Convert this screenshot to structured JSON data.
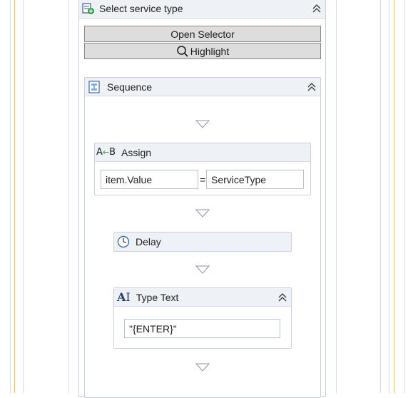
{
  "select_service": {
    "title": "Select service type",
    "open_selector_label": "Open Selector",
    "highlight_label": "Highlight"
  },
  "sequence": {
    "title": "Sequence"
  },
  "assign": {
    "title": "Assign",
    "left_value": "item.Value",
    "operator": "=",
    "right_value": "ServiceType"
  },
  "delay": {
    "title": "Delay"
  },
  "type_text": {
    "title": "Type Text",
    "text_value": "\"{ENTER}\""
  },
  "icons": {
    "select_service": "select-item-icon",
    "sequence": "sequence-icon",
    "assign": "assign-icon",
    "delay": "clock-icon",
    "type_text": "type-text-icon",
    "highlight": "magnifier-icon",
    "collapse": "double-chevron-up-icon",
    "drop": "drop-target-triangle-icon"
  },
  "colors": {
    "guide_gold": "#e8c46a",
    "guide_grey": "#d8dbe4",
    "header_bg": "#eef1f6",
    "button_bg": "#dddddd"
  }
}
